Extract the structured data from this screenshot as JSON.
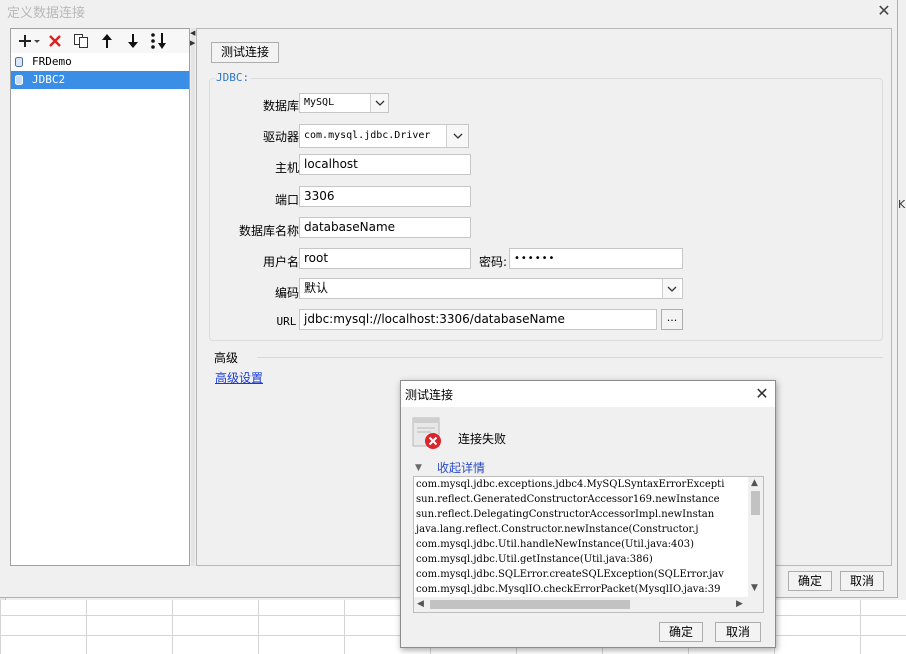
{
  "main_dialog": {
    "title": "定义数据连接",
    "ok_label": "确定",
    "cancel_label": "取消"
  },
  "connections": {
    "items": [
      {
        "name": "FRDemo",
        "selected": false
      },
      {
        "name": "JDBC2",
        "selected": true
      }
    ]
  },
  "toolbar": {
    "icons": [
      "add-icon",
      "delete-icon",
      "copy-icon",
      "move-up-icon",
      "move-down-icon",
      "sort-icon"
    ]
  },
  "form": {
    "test_button": "测试连接",
    "group_label": "JDBC:",
    "database_label": "数据库:",
    "database_value": "MySQL",
    "driver_label": "驱动器:",
    "driver_value": "com.mysql.jdbc.Driver",
    "host_label": "主机:",
    "host_value": "localhost",
    "port_label": "端口:",
    "port_value": "3306",
    "dbname_label": "数据库名称:",
    "dbname_value": "databaseName",
    "user_label": "用户名:",
    "user_value": "root",
    "password_label": "密码:",
    "password_value": "••••••",
    "encoding_label": "编码:",
    "encoding_value": "默认",
    "url_label": "URL:",
    "url_value": "jdbc:mysql://localhost:3306/databaseName",
    "url_browse": "...",
    "advanced_title": "高级",
    "advanced_link": "高级设置"
  },
  "popup": {
    "title": "测试连接",
    "status": "连接失败",
    "collapse_label": "收起详情",
    "ok_label": "确定",
    "cancel_label": "取消",
    "stack_trace": [
      "com.mysql.jdbc.exceptions.jdbc4.MySQLSyntaxErrorExcepti",
      "sun.reflect.GeneratedConstructorAccessor169.newInstance",
      "sun.reflect.DelegatingConstructorAccessorImpl.newInstan",
      "java.lang.reflect.Constructor.newInstance(Constructor.j",
      "com.mysql.jdbc.Util.handleNewInstance(Util.java:403)",
      "com.mysql.jdbc.Util.getInstance(Util.java:386)",
      "com.mysql.jdbc.SQLError.createSQLException(SQLError.jav",
      "com.mysql.jdbc.MysqlIO.checkErrorPacket(MysqlIO.java:39"
    ]
  },
  "background": {
    "edge_letter": "K"
  },
  "colors": {
    "selection": "#3a8ee6",
    "link": "#1a3bd6",
    "group_label": "#2f77c8",
    "error": "#d9262c"
  }
}
